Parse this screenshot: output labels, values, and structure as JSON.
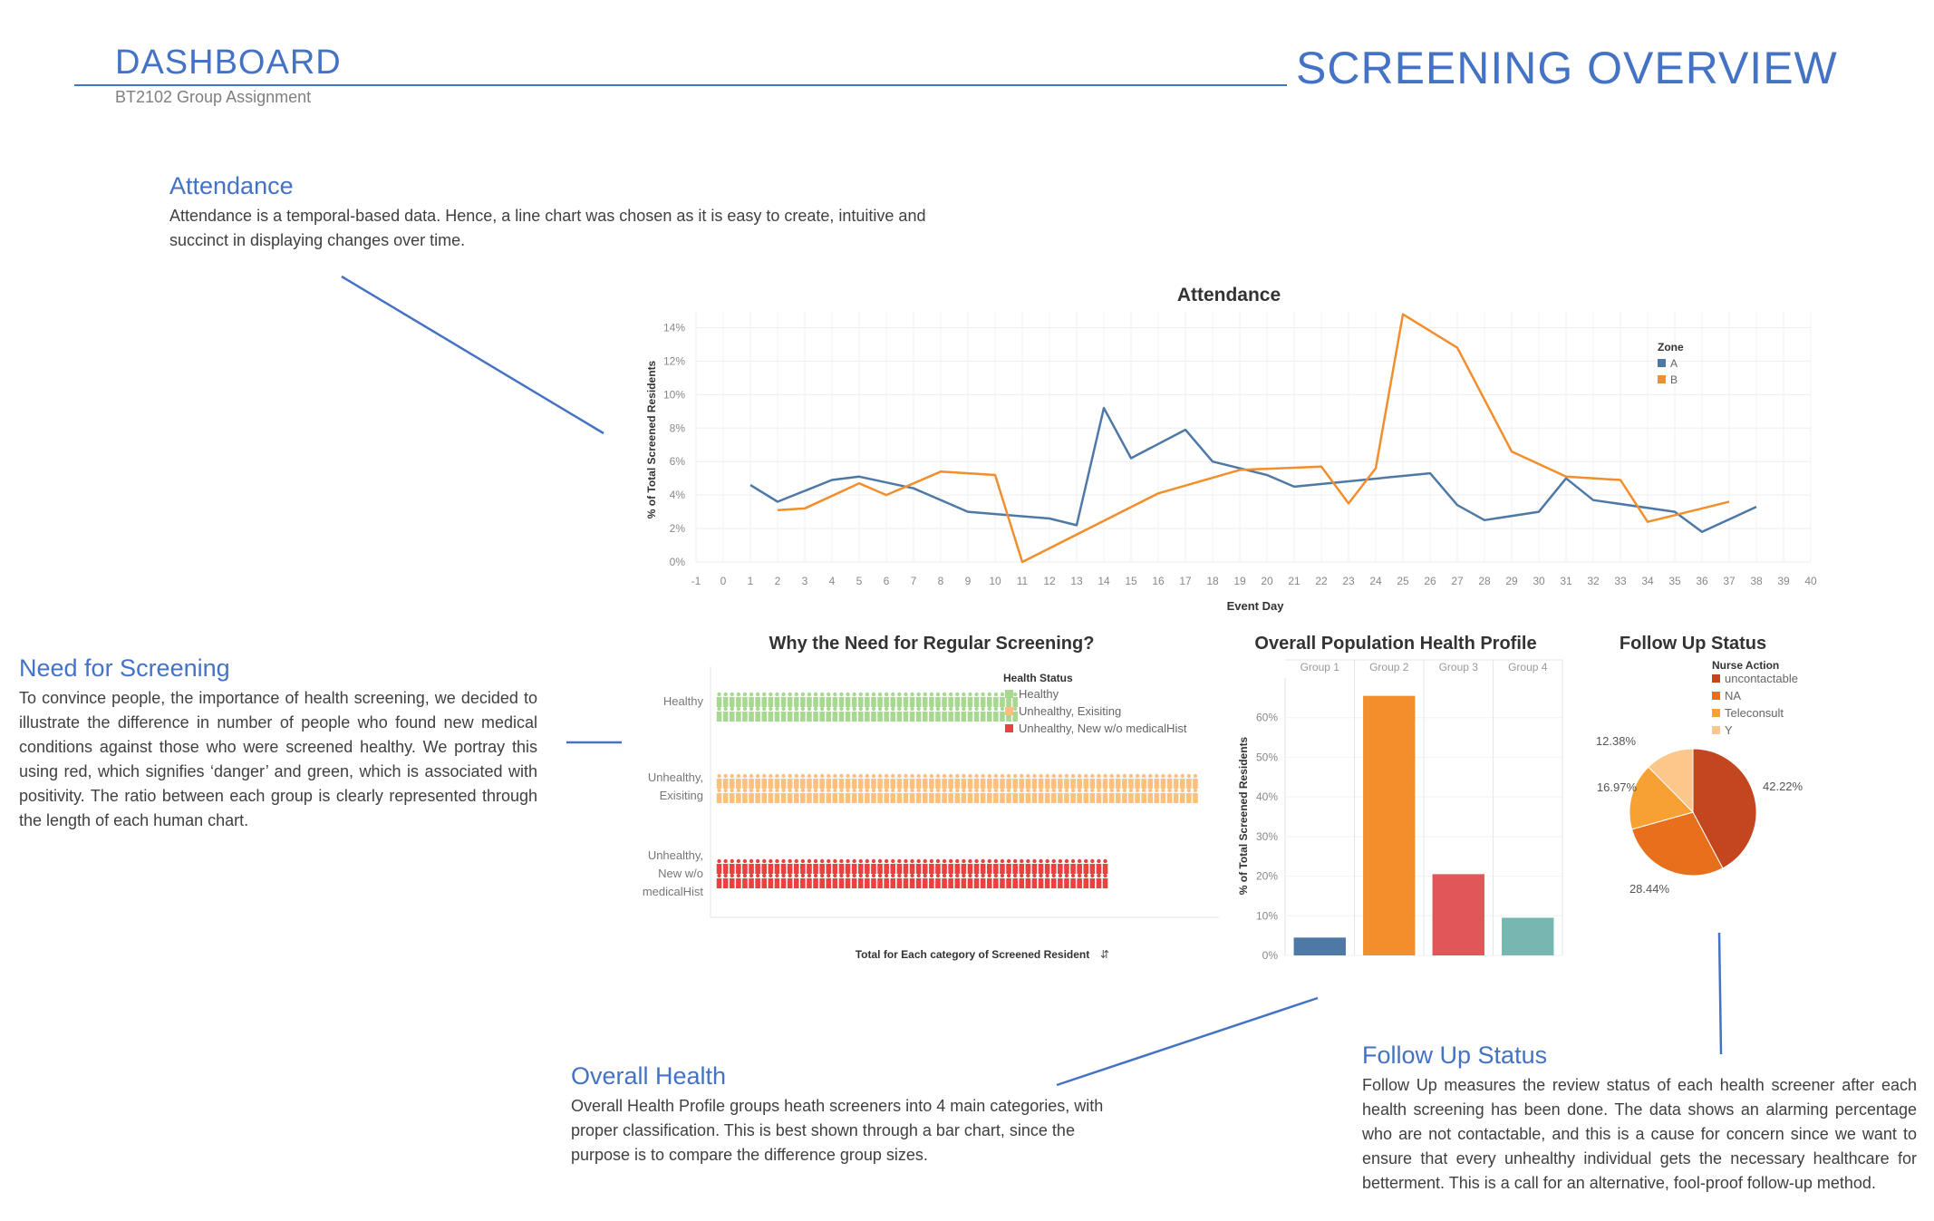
{
  "header": {
    "title": "DASHBOARD",
    "subtitle": "BT2102 Group Assignment",
    "page_title": "SCREENING OVERVIEW"
  },
  "sections": {
    "attendance": {
      "heading": "Attendance",
      "text": "Attendance is a temporal-based data. Hence, a line chart was chosen as it is easy to create, intuitive and succinct in displaying changes over time."
    },
    "need": {
      "heading": "Need for Screening",
      "text": "To convince people, the importance of health screening, we decided to illustrate the difference in number of people who found new medical conditions against those who were screened healthy. We portray this using red, which signifies ‘danger’ and green, which is associated with positivity. The ratio between each group is clearly represented through the length of each human chart."
    },
    "overall": {
      "heading": "Overall Health",
      "text": "Overall Health Profile groups heath screeners into 4 main categories, with proper classification. This is best shown through a bar chart, since the purpose is to compare the difference group sizes."
    },
    "followup": {
      "heading": "Follow Up Status",
      "text": "Follow Up measures the review status of each health screener after each health screening has been done. The data shows an alarming percentage who are not contactable, and this is a cause for concern since we want to ensure that every unhealthy individual gets the necessary healthcare for betterment. This is a call for an alternative, fool-proof follow-up method."
    }
  },
  "chart_data": [
    {
      "id": "attendance",
      "type": "line",
      "title": "Attendance",
      "xlabel": "Event Day",
      "ylabel": "% of Total Screened Residents",
      "xlim": [
        -1,
        40
      ],
      "ylim": [
        0,
        15
      ],
      "x_ticks": [
        -1,
        0,
        1,
        2,
        3,
        4,
        5,
        6,
        7,
        8,
        9,
        10,
        11,
        12,
        13,
        14,
        15,
        16,
        17,
        18,
        19,
        20,
        21,
        22,
        23,
        24,
        25,
        26,
        27,
        28,
        29,
        30,
        31,
        32,
        33,
        34,
        35,
        36,
        37,
        38,
        39,
        40
      ],
      "y_ticks": [
        0,
        2,
        4,
        6,
        8,
        10,
        12,
        14
      ],
      "y_tick_suffix": "%",
      "legend": {
        "title": "Zone",
        "position": "top-right"
      },
      "series": [
        {
          "name": "A",
          "color": "#4e79a7",
          "points": [
            [
              1,
              4.6
            ],
            [
              2,
              3.6
            ],
            [
              4,
              4.9
            ],
            [
              5,
              5.1
            ],
            [
              7,
              4.4
            ],
            [
              9,
              3.0
            ],
            [
              12,
              2.6
            ],
            [
              13,
              2.2
            ],
            [
              14,
              9.2
            ],
            [
              15,
              6.2
            ],
            [
              17,
              7.9
            ],
            [
              18,
              6.0
            ],
            [
              20,
              5.2
            ],
            [
              21,
              4.5
            ],
            [
              26,
              5.3
            ],
            [
              27,
              3.4
            ],
            [
              28,
              2.5
            ],
            [
              30,
              3.0
            ],
            [
              31,
              5.0
            ],
            [
              32,
              3.7
            ],
            [
              35,
              3.0
            ],
            [
              36,
              1.8
            ],
            [
              38,
              3.3
            ]
          ]
        },
        {
          "name": "B",
          "color": "#f28e2b",
          "points": [
            [
              2,
              3.1
            ],
            [
              3,
              3.2
            ],
            [
              5,
              4.7
            ],
            [
              6,
              4.0
            ],
            [
              8,
              5.4
            ],
            [
              10,
              5.2
            ],
            [
              11,
              0.0
            ],
            [
              16,
              4.1
            ],
            [
              19,
              5.5
            ],
            [
              22,
              5.7
            ],
            [
              23,
              3.5
            ],
            [
              24,
              5.6
            ],
            [
              25,
              14.8
            ],
            [
              27,
              12.8
            ],
            [
              29,
              6.6
            ],
            [
              31,
              5.1
            ],
            [
              33,
              4.9
            ],
            [
              34,
              2.4
            ],
            [
              35,
              2.8
            ],
            [
              37,
              3.6
            ]
          ]
        }
      ]
    },
    {
      "id": "regular-screening",
      "type": "bar",
      "title": "Why the Need for Regular Screening?",
      "xlabel": "Total for Each category of Screened Resident",
      "categories": [
        "Healthy",
        "Unhealthy, Exisiting",
        "Unhealthy, New w/o medicalHist"
      ],
      "category_labels": [
        [
          "Healthy"
        ],
        [
          "Unhealthy,",
          "Exisiting"
        ],
        [
          "Unhealthy,",
          "New w/o",
          "medicalHist"
        ]
      ],
      "values": [
        47,
        75,
        61
      ],
      "colors": [
        "#a6d88f",
        "#ffc07d",
        "#e8413f"
      ],
      "legend": {
        "title": "Health Status",
        "position": "top-right",
        "items": [
          "Healthy",
          "Unhealthy, Exisiting",
          "Unhealthy, New w/o medicalHist"
        ]
      }
    },
    {
      "id": "health-profile",
      "type": "bar",
      "title": "Overall Population Health Profile",
      "ylabel": "% of Total Screened Residents",
      "categories": [
        "Group 1",
        "Group 2",
        "Group 3",
        "Group 4"
      ],
      "values": [
        4.5,
        65.5,
        20.5,
        9.5
      ],
      "colors": [
        "#4e79a7",
        "#f28e2b",
        "#e15759",
        "#76b7b2"
      ],
      "ylim": [
        0,
        70
      ],
      "y_ticks": [
        0,
        10,
        20,
        30,
        40,
        50,
        60
      ],
      "y_tick_suffix": "%"
    },
    {
      "id": "follow-up",
      "type": "pie",
      "title": "Follow Up Status",
      "legend": {
        "title": "Nurse Action",
        "position": "top-right"
      },
      "categories": [
        "uncontactable",
        "NA",
        "Teleconsult",
        "Y"
      ],
      "values": [
        42.22,
        28.44,
        16.97,
        12.38
      ],
      "value_labels": [
        "42.22%",
        "28.44%",
        "16.97%",
        "12.38%"
      ],
      "colors": [
        "#c4461f",
        "#e8701c",
        "#f7a134",
        "#fbc78a"
      ]
    }
  ]
}
